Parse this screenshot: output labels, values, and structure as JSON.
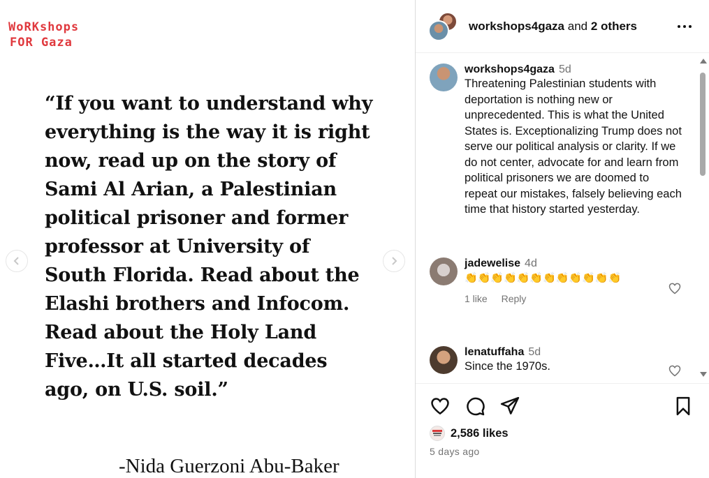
{
  "media": {
    "logo_line1": "WoRKshops",
    "logo_line2": "FOR Gaza",
    "quote": "“If you want to understand why everything is the way it is right now, read up on the story of Sami Al Arian, a Palestinian political prisoner and former professor at University of South Florida. Read about the Elashi brothers and Infocom. Read about the Holy Land Five…It all started decades ago, on U.S. soil.”",
    "attribution": "-Nida Guerzoni Abu-Baker"
  },
  "header": {
    "username": "workshops4gaza",
    "and_text": "and",
    "others": "2 others"
  },
  "caption": {
    "username": "workshops4gaza",
    "time": "5d",
    "text": "Threatening Palestinian students with deportation is nothing new or unprecedented. This is what the United States is. Exceptionalizing Trump does not serve our political analysis or clarity. If we do not center, advocate for and learn from political prisoners we are doomed to repeat our mistakes, falsely believing each time that history started yesterday."
  },
  "comments": [
    {
      "username": "jadewelise",
      "time": "4d",
      "text": "👏👏👏👏👏👏👏👏👏👏👏👏",
      "likes": "1 like",
      "reply": "Reply"
    },
    {
      "username": "lenatuffaha",
      "time": "5d",
      "text": "Since the 1970s."
    }
  ],
  "footer": {
    "likes": "2,586 likes",
    "posted": "5 days ago"
  },
  "colors": {
    "logo_red": "#e0393e",
    "meta_gray": "#737373",
    "border": "#dbdbdb"
  },
  "icons": [
    "chevron-left-icon",
    "chevron-right-icon",
    "more-icon",
    "heart-icon",
    "comment-icon",
    "share-icon",
    "bookmark-icon"
  ]
}
